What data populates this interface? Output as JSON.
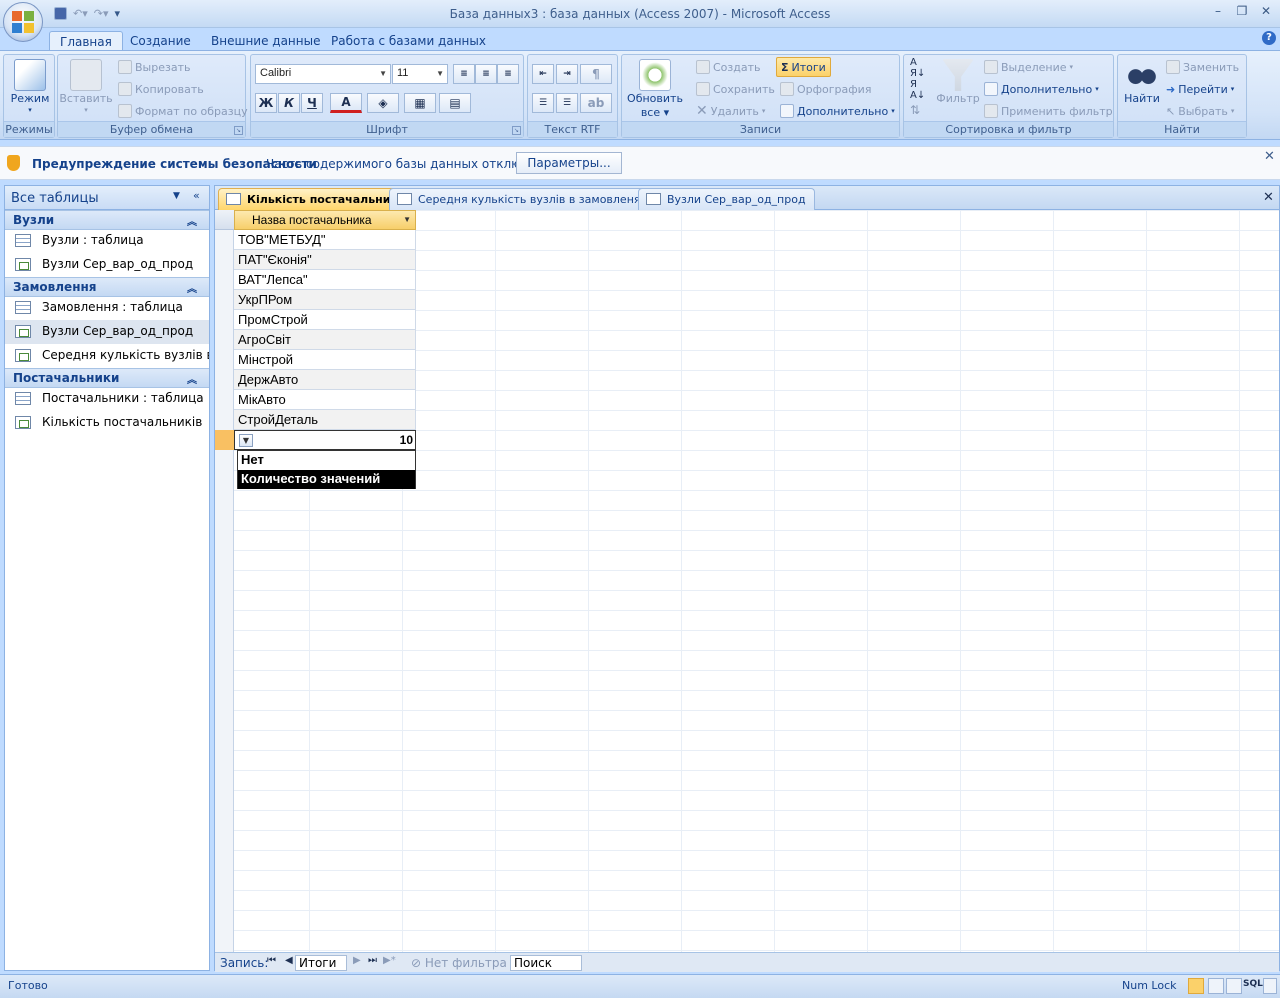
{
  "window": {
    "title": "База данных3 : база данных (Access 2007) - Microsoft Access",
    "minimize": "–",
    "maximize": "❐",
    "close": "✕"
  },
  "qat": {
    "customize": "▾"
  },
  "ribbon_tabs": [
    "Главная",
    "Создание",
    "Внешние данные",
    "Работа с базами данных"
  ],
  "help_label": "?",
  "groups": {
    "modes": {
      "label": "Режимы",
      "view_button": "Режим"
    },
    "clipboard": {
      "label": "Буфер обмена",
      "paste": "Вставить",
      "cut": "Вырезать",
      "copy": "Копировать",
      "format_painter": "Формат по образцу"
    },
    "font": {
      "label": "Шрифт",
      "font_name": "Calibri",
      "font_size": "11",
      "bold": "Ж",
      "italic": "К",
      "underline": "Ч",
      "font_color": "A"
    },
    "rtf": {
      "label": "Текст RTF"
    },
    "records": {
      "label": "Записи",
      "refresh": "Обновить",
      "refresh2": "все",
      "new": "Создать",
      "save": "Сохранить",
      "delete": "Удалить",
      "totals": "Итоги",
      "spelling": "Орфография",
      "more": "Дополнительно"
    },
    "sort": {
      "label": "Сортировка и фильтр",
      "filter": "Фильтр",
      "selection": "Выделение",
      "advanced": "Дополнительно",
      "apply": "Применить фильтр"
    },
    "find": {
      "label": "Найти",
      "find": "Найти",
      "replace": "Заменить",
      "goto": "Перейти",
      "select": "Выбрать"
    }
  },
  "security_bar": {
    "title": "Предупреждение системы безопасности",
    "message": "Часть содержимого базы данных отключено",
    "options_button": "Параметры...",
    "close": "✕"
  },
  "nav_pane": {
    "header": "Все таблицы",
    "groups": [
      {
        "name": "Вузли",
        "items": [
          "Вузли : таблица",
          "Вузли Сер_вар_од_прод"
        ]
      },
      {
        "name": "Замовлення",
        "items": [
          "Замовлення : таблица",
          "Вузли Сер_вар_од_прод",
          "Середня кулькість вузлів в з..."
        ]
      },
      {
        "name": "Постачальники",
        "items": [
          "Постачальники : таблица",
          "Кількість постачальників"
        ]
      }
    ]
  },
  "doc_tabs": [
    "Кількість постачальників",
    "Середня кулькість вузлів в замовленях",
    "Вузли Сер_вар_од_прод"
  ],
  "doc_close": "✕",
  "datasheet": {
    "column_header": "Назва постачальника",
    "rows": [
      "ТОВ\"МЕТБУД\"",
      "ПАТ\"Єконія\"",
      "ВАТ\"Лепса\"",
      "УкрПРом",
      "ПромСтрой",
      "АгроСвіт",
      "Мінстрой",
      "ДержАвто",
      "МікАвто",
      "СтройДеталь"
    ],
    "total_value": "10",
    "dropdown_options": [
      "Нет",
      "Количество значений"
    ]
  },
  "record_nav": {
    "label": "Запись:",
    "current": "Итоги",
    "filter_status": "Нет фильтра",
    "search": "Поиск"
  },
  "statusbar": {
    "left": "Готово",
    "numlock": "Num Lock",
    "sql": "SQL"
  },
  "colors": {
    "accent": "#f7cf6a",
    "ribbon": "#dfeafa",
    "brand": "#15428b"
  }
}
